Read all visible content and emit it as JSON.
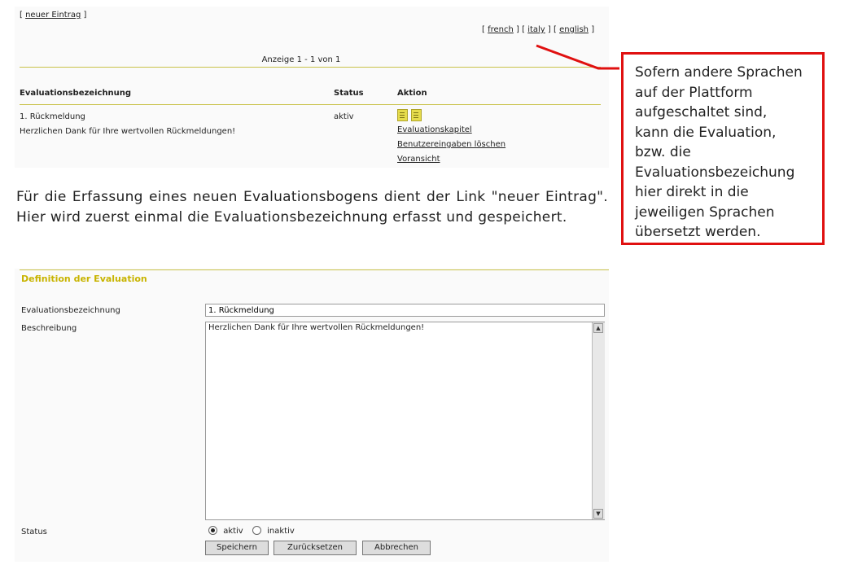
{
  "top": {
    "new_entry_prefix": "[ ",
    "new_entry_link": "neuer Eintrag",
    "new_entry_suffix": " ]",
    "lang_open1": "[ ",
    "lang_french": "french",
    "lang_sep1": " ] [ ",
    "lang_italy": "italy",
    "lang_sep2": " ] [ ",
    "lang_english": "english",
    "lang_close": " ]",
    "pager": "Anzeige 1 - 1 von 1"
  },
  "table": {
    "headers": [
      "Evaluationsbezeichnung",
      "Status",
      "Aktion"
    ],
    "row": {
      "title": "1. Rückmeldung",
      "description": "Herzlichen Dank für Ihre wertvollen Rückmeldungen!",
      "status": "aktiv",
      "actions": [
        "Evaluationskapitel",
        "Benutzereingaben löschen",
        "Voransicht"
      ]
    }
  },
  "paragraph": "Für die Erfassung eines neuen Evaluationsbogens dient der Link \"neuer Eintrag\". Hier wird zuerst einmal die Evaluationsbezeichnung erfasst und gespeichert.",
  "callout": {
    "lines": [
      "Sofern andere Sprachen",
      "auf der Plattform",
      "aufgeschaltet sind,",
      "kann die Evaluation,",
      "bzw. die",
      "Evaluationsbezeichung",
      "hier direkt in die",
      "jeweiligen Sprachen",
      "übersetzt werden."
    ],
    "border_color": "#e01010"
  },
  "form": {
    "section_title": "Definition der Evaluation",
    "name_label": "Evaluationsbezeichnung",
    "name_value": "1. Rückmeldung",
    "desc_label": "Beschreibung",
    "desc_value": "Herzlichen Dank für Ihre wertvollen Rückmeldungen!",
    "status_label": "Status",
    "status_active": "aktiv",
    "status_inactive": "inaktiv",
    "status_selected": "aktiv",
    "buttons": [
      "Speichern",
      "Zurücksetzen",
      "Abbrechen"
    ]
  },
  "colors": {
    "accent": "#c9c24a",
    "section_title": "#c8b400"
  }
}
